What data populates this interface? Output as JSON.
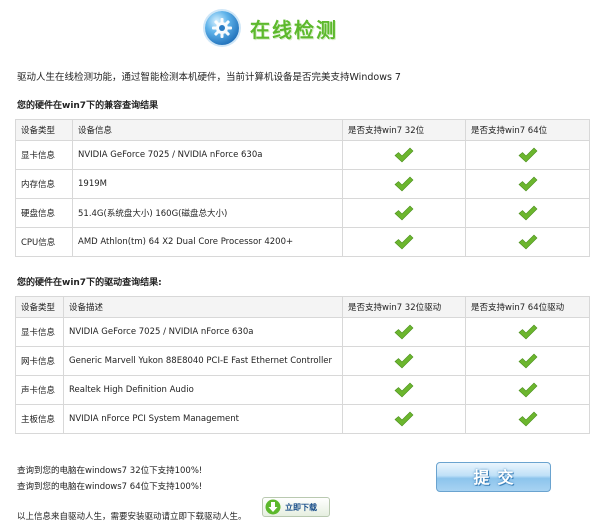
{
  "header": {
    "title": "在线检测",
    "logo_icon": "gear-icon"
  },
  "intro": "驱动人生在线检测功能，通过智能检测本机硬件，当前计算机设备是否完美支持Windows 7",
  "hardware": {
    "section_title": "您的硬件在win7下的兼容查询结果",
    "headers": [
      "设备类型",
      "设备信息",
      "是否支持win7 32位",
      "是否支持win7 64位"
    ],
    "rows": [
      {
        "type": "显卡信息",
        "info": "NVIDIA GeForce 7025 / NVIDIA nForce 630a",
        "win7_32": true,
        "win7_64": true
      },
      {
        "type": "内存信息",
        "info": "1919M",
        "win7_32": true,
        "win7_64": true
      },
      {
        "type": "硬盘信息",
        "info": "51.4G(系统盘大小) 160G(磁盘总大小)",
        "win7_32": true,
        "win7_64": true
      },
      {
        "type": "CPU信息",
        "info": "AMD Athlon(tm) 64 X2 Dual Core Processor 4200+",
        "win7_32": true,
        "win7_64": true
      }
    ]
  },
  "drivers": {
    "section_title": "您的硬件在win7下的驱动查询结果:",
    "headers": [
      "设备类型",
      "设备描述",
      "是否支持win7 32位驱动",
      "是否支持win7 64位驱动"
    ],
    "rows": [
      {
        "type": "显卡信息",
        "info": "NVIDIA GeForce 7025 / NVIDIA nForce 630a",
        "win7_32": true,
        "win7_64": true
      },
      {
        "type": "网卡信息",
        "info": "Generic Marvell Yukon 88E8040 PCI-E Fast Ethernet Controller",
        "win7_32": true,
        "win7_64": true
      },
      {
        "type": "声卡信息",
        "info": "Realtek High Definition Audio",
        "win7_32": true,
        "win7_64": true
      },
      {
        "type": "主板信息",
        "info": "NVIDIA nForce PCI System Management",
        "win7_32": true,
        "win7_64": true
      }
    ]
  },
  "summary": {
    "line_32": "查询到您的电脑在windows7 32位下支持100%!",
    "line_64": "查询到您的电脑在windows7 64位下支持100%!"
  },
  "submit_label": "提交",
  "footer": {
    "text": "以上信息来自驱动人生，需要安装驱动请立即下载驱动人生。",
    "download_label": "立即下载"
  },
  "colors": {
    "check_green": "#6cb62e",
    "title_green": "#5db92d",
    "submit_blue": "#8cc4ec"
  }
}
